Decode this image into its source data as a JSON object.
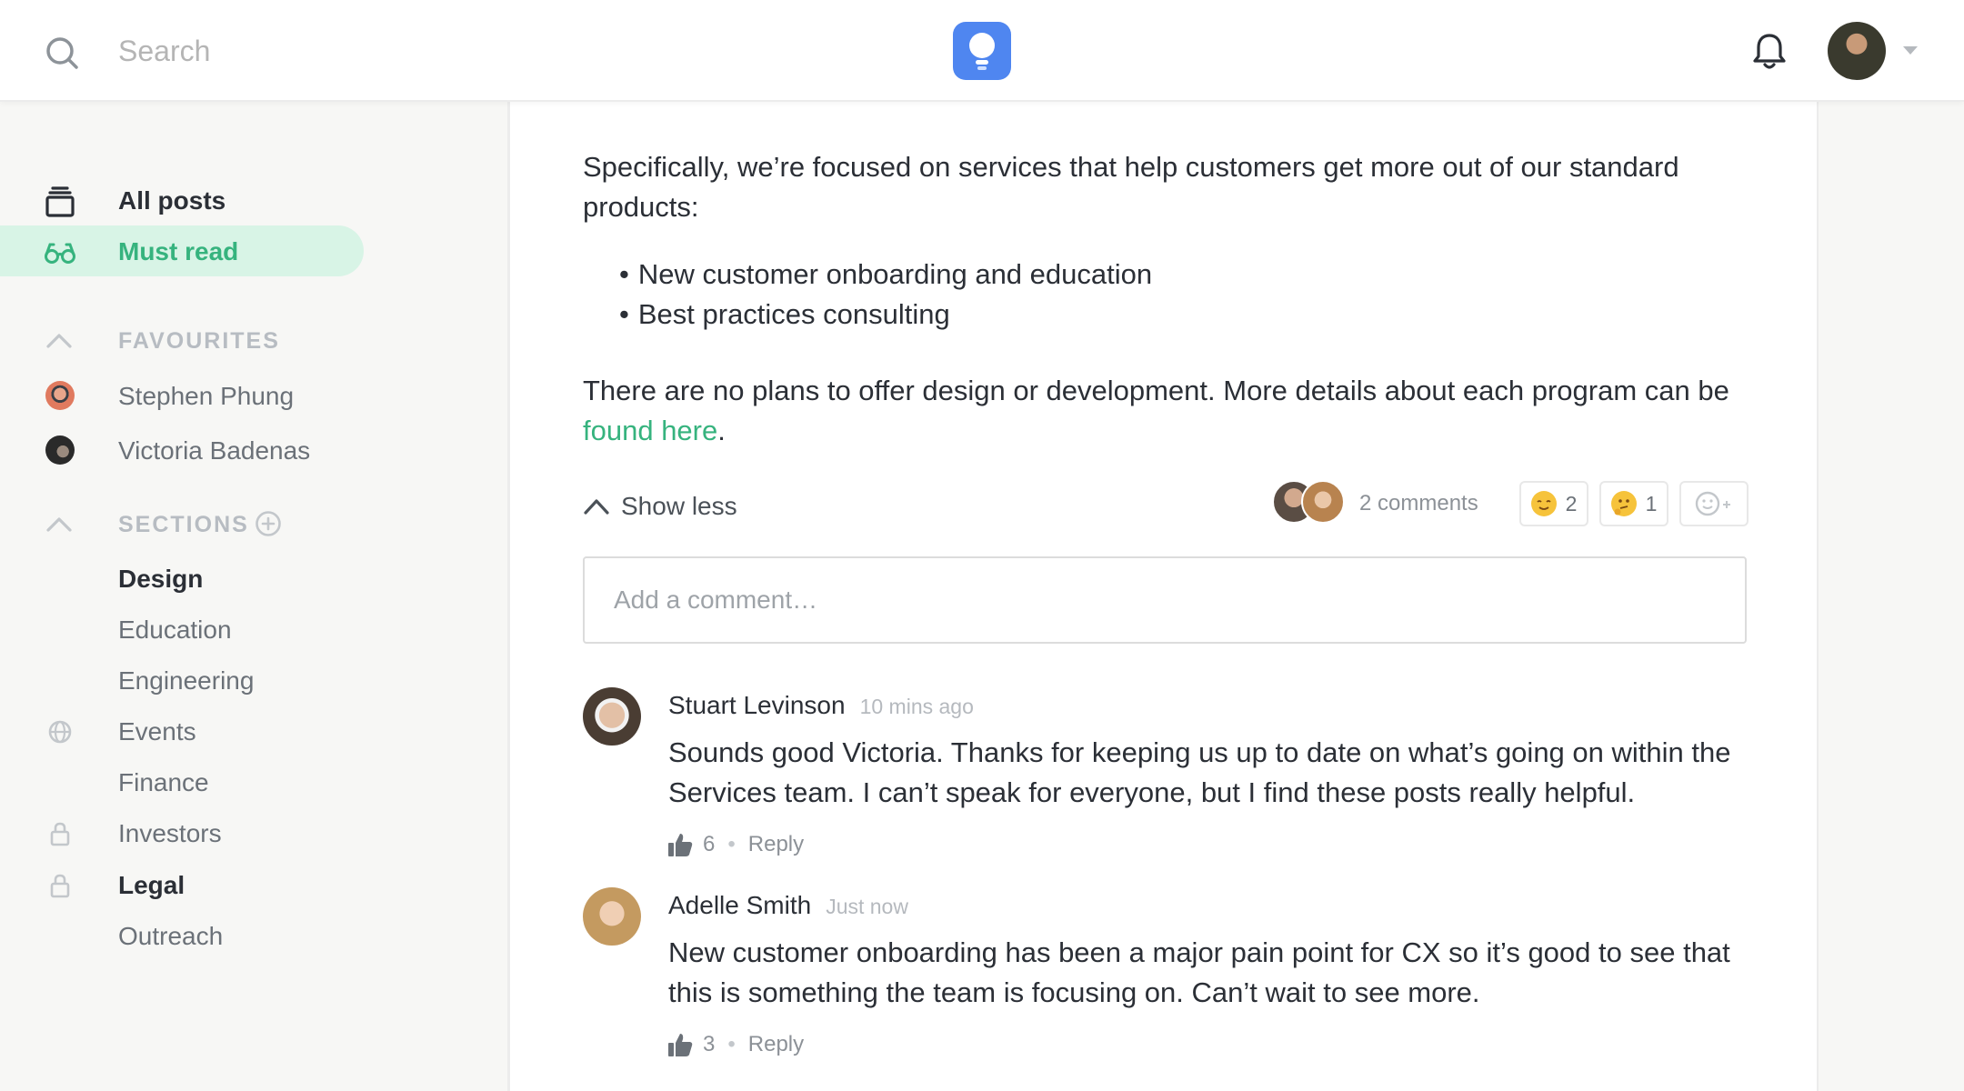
{
  "header": {
    "search_placeholder": "Search",
    "logo_icon": "lightbulb-icon",
    "notification_icon": "bell-icon",
    "accent_color": "#4f86f0"
  },
  "sidebar": {
    "nav": [
      {
        "label": "All posts",
        "icon": "layers-icon",
        "active": false
      },
      {
        "label": "Must read",
        "icon": "glasses-icon",
        "active": true
      }
    ],
    "favourites_heading": "FAVOURITES",
    "favourites": [
      {
        "name": "Stephen Phung"
      },
      {
        "name": "Victoria Badenas"
      }
    ],
    "sections_heading": "SECTIONS",
    "sections": [
      {
        "label": "Design",
        "bold": true,
        "icon": ""
      },
      {
        "label": "Education",
        "bold": false,
        "icon": ""
      },
      {
        "label": "Engineering",
        "bold": false,
        "icon": ""
      },
      {
        "label": "Events",
        "bold": false,
        "icon": "globe-icon"
      },
      {
        "label": "Finance",
        "bold": false,
        "icon": ""
      },
      {
        "label": "Investors",
        "bold": false,
        "icon": "lock-icon"
      },
      {
        "label": "Legal",
        "bold": true,
        "icon": "lock-icon"
      },
      {
        "label": "Outreach",
        "bold": false,
        "icon": ""
      }
    ],
    "active_color": "#36b37e"
  },
  "post": {
    "intro": "Specifically, we’re focused on services that help customers get more out of our standard products:",
    "bullets": [
      "New customer onboarding and education",
      "Best practices consulting"
    ],
    "outro_text": "There are no plans to offer design or development. More details about each program can be ",
    "outro_link": "found here",
    "outro_end": ".",
    "show_less": "Show less",
    "comments_count": "2 comments",
    "reactions": [
      {
        "emoji": "relieved-face-icon",
        "count": "2"
      },
      {
        "emoji": "thinking-face-icon",
        "count": "1"
      }
    ],
    "add_reaction_icon": "add-reaction-icon",
    "comment_placeholder": "Add a comment…"
  },
  "comments": [
    {
      "author": "Stuart Levinson",
      "time": "10 mins ago",
      "body": "Sounds good Victoria. Thanks for keeping us up to date on what’s going on within the Services team. I can’t speak for everyone, but I find these posts really helpful.",
      "likes": "6",
      "reply": "Reply"
    },
    {
      "author": "Adelle Smith",
      "time": "Just now",
      "body": "New customer onboarding has been a major pain point for CX so it’s good to see that this is something the team is focusing on. Can’t wait to see more.",
      "likes": "3",
      "reply": "Reply"
    }
  ]
}
